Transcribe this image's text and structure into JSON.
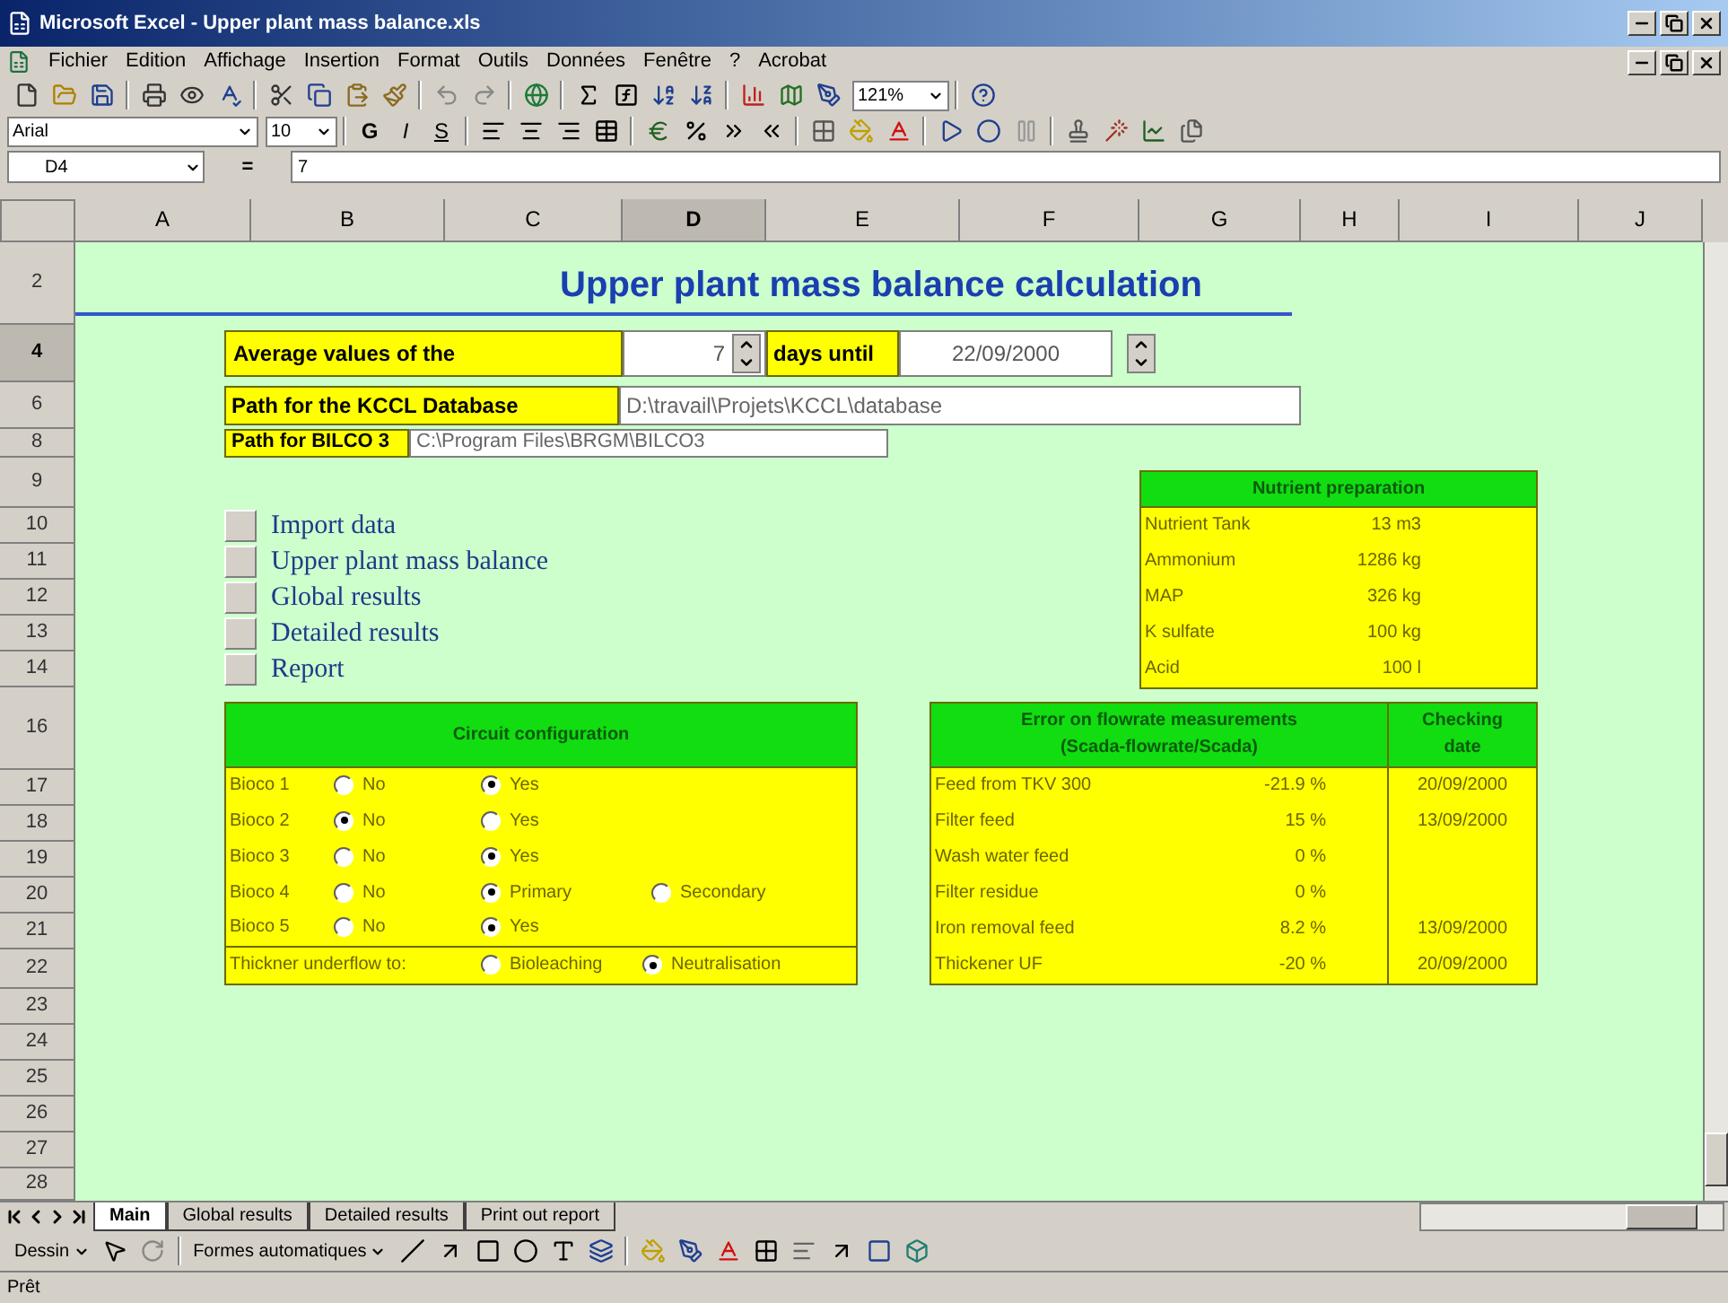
{
  "window": {
    "title": "Microsoft Excel - Upper plant mass balance.xls"
  },
  "menu": [
    "Fichier",
    "Edition",
    "Affichage",
    "Insertion",
    "Format",
    "Outils",
    "Données",
    "Fenêtre",
    "?",
    "Acrobat"
  ],
  "toolbar": {
    "zoom": "121%",
    "font": "Arial",
    "size": "10",
    "style_buttons": [
      "G",
      "I",
      "S"
    ]
  },
  "formula_bar": {
    "name_box": "D4",
    "equals": "=",
    "content": "7"
  },
  "columns": [
    {
      "label": "A",
      "selected": false
    },
    {
      "label": "B",
      "selected": false
    },
    {
      "label": "C",
      "selected": false
    },
    {
      "label": "D",
      "selected": true
    },
    {
      "label": "E",
      "selected": false
    },
    {
      "label": "F",
      "selected": false
    },
    {
      "label": "G",
      "selected": false
    },
    {
      "label": "H",
      "selected": false
    },
    {
      "label": "I",
      "selected": false
    },
    {
      "label": "J",
      "selected": false
    }
  ],
  "rows": [
    {
      "label": "2",
      "selected": false
    },
    {
      "label": "4",
      "selected": true
    },
    {
      "label": "6",
      "selected": false
    },
    {
      "label": "8",
      "selected": false
    },
    {
      "label": "9",
      "selected": false
    },
    {
      "label": "10",
      "selected": false
    },
    {
      "label": "11",
      "selected": false
    },
    {
      "label": "12",
      "selected": false
    },
    {
      "label": "13",
      "selected": false
    },
    {
      "label": "14",
      "selected": false
    },
    {
      "label": "16",
      "selected": false
    },
    {
      "label": "17",
      "selected": false
    },
    {
      "label": "18",
      "selected": false
    },
    {
      "label": "19",
      "selected": false
    },
    {
      "label": "20",
      "selected": false
    },
    {
      "label": "21",
      "selected": false
    },
    {
      "label": "22",
      "selected": false
    },
    {
      "label": "23",
      "selected": false
    },
    {
      "label": "24",
      "selected": false
    },
    {
      "label": "25",
      "selected": false
    },
    {
      "label": "26",
      "selected": false
    },
    {
      "label": "27",
      "selected": false
    },
    {
      "label": "28",
      "selected": false
    }
  ],
  "sheet": {
    "title": "Upper plant mass balance calculation",
    "average": {
      "label": "Average values of the",
      "days": "7",
      "until_label": "days until",
      "date": "22/09/2000"
    },
    "paths": [
      {
        "label": "Path for the KCCL Database",
        "value": "D:\\travail\\Projets\\KCCL\\database"
      },
      {
        "label": "Path for BILCO 3",
        "value": "C:\\Program Files\\BRGM\\BILCO3"
      }
    ],
    "macro_buttons": [
      "Import data",
      "Upper plant mass balance",
      "Global results",
      "Detailed results",
      "Report"
    ],
    "nutrient": {
      "title": "Nutrient preparation",
      "rows": [
        {
          "label": "Nutrient Tank",
          "value": "13 m3"
        },
        {
          "label": "Ammonium",
          "value": "1286 kg"
        },
        {
          "label": "MAP",
          "value": "326 kg"
        },
        {
          "label": "K sulfate",
          "value": "100 kg"
        },
        {
          "label": "Acid",
          "value": "100 l"
        }
      ]
    },
    "circuit": {
      "title": "Circuit configuration",
      "rows": [
        {
          "label": "Bioco 1",
          "options": [
            {
              "label": "No",
              "selected": false
            },
            {
              "label": "Yes",
              "selected": true
            }
          ]
        },
        {
          "label": "Bioco 2",
          "options": [
            {
              "label": "No",
              "selected": true
            },
            {
              "label": "Yes",
              "selected": false
            }
          ]
        },
        {
          "label": "Bioco 3",
          "options": [
            {
              "label": "No",
              "selected": false
            },
            {
              "label": "Yes",
              "selected": true
            }
          ]
        },
        {
          "label": "Bioco 4",
          "options": [
            {
              "label": "No",
              "selected": false
            },
            {
              "label": "Primary",
              "selected": true
            },
            {
              "label": "Secondary",
              "selected": false
            }
          ]
        },
        {
          "label": "Bioco 5",
          "options": [
            {
              "label": "No",
              "selected": false
            },
            {
              "label": "Yes",
              "selected": true
            }
          ]
        }
      ],
      "underflow": {
        "label": "Thickner underflow to:",
        "options": [
          {
            "label": "Bioleaching",
            "selected": false
          },
          {
            "label": "Neutralisation",
            "selected": true
          }
        ]
      }
    },
    "errors": {
      "title": "Error on flowrate measurements",
      "subtitle": "(Scada-flowrate/Scada)",
      "date_header": "Checking date",
      "rows": [
        {
          "label": "Feed from TKV 300",
          "value": "-21.9 %",
          "date": "20/09/2000"
        },
        {
          "label": "Filter feed",
          "value": "15 %",
          "date": "13/09/2000"
        },
        {
          "label": "Wash water feed",
          "value": "0 %"
        },
        {
          "label": "Filter residue",
          "value": "0 %"
        },
        {
          "label": "Iron removal feed",
          "value": "8.2 %",
          "date": "13/09/2000"
        },
        {
          "label": "Thickener UF",
          "value": "-20 %",
          "date": "20/09/2000"
        }
      ]
    }
  },
  "sheet_tabs": [
    {
      "label": "Main",
      "selected": true
    },
    {
      "label": "Global results",
      "selected": false
    },
    {
      "label": "Detailed results",
      "selected": false
    },
    {
      "label": "Print out report",
      "selected": false
    }
  ],
  "drawing_toolbar": {
    "draw_menu": "Dessin",
    "autoshapes_menu": "Formes automatiques"
  },
  "status_bar": "Prêt"
}
